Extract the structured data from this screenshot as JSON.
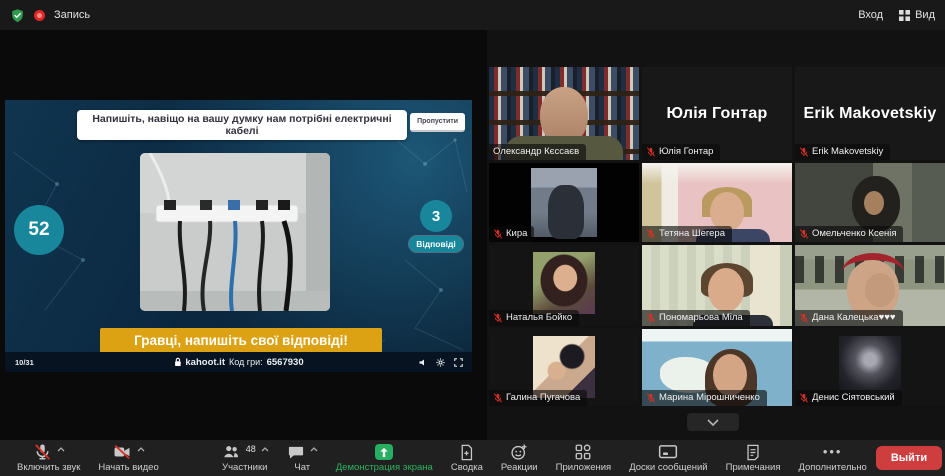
{
  "topbar": {
    "record_label": "Запись",
    "signin_label": "Вход",
    "view_label": "Вид"
  },
  "kahoot": {
    "question": "Напишіть, навіщо на вашу думку нам потрібні електричні кабелі",
    "skip_button": "Пропустити",
    "timer_seconds": "52",
    "answers_count": "3",
    "answers_label": "Відповіді",
    "banner": "Гравці, напишіть свої відповіді!",
    "slide_progress": "10/31",
    "site": "kahoot.it",
    "game_code_label": "Код гри:",
    "game_code": "6567930"
  },
  "gallery": {
    "participants": [
      {
        "name": "Олександр Кєссаєв",
        "muted": false,
        "video": "on",
        "active_speaker": true
      },
      {
        "name": "Юлія Гонтар",
        "muted": true,
        "video": "off-name"
      },
      {
        "name": "Erik Makovetskiy",
        "muted": true,
        "video": "off-name"
      },
      {
        "name": "Кира",
        "muted": true,
        "video": "on"
      },
      {
        "name": "Тетяна Шегера",
        "muted": true,
        "video": "on"
      },
      {
        "name": "Омельченко Ксенія",
        "muted": true,
        "video": "on"
      },
      {
        "name": "Наталья Бойко",
        "muted": true,
        "video": "off-avatar"
      },
      {
        "name": "Пономарьова Міла",
        "muted": true,
        "video": "on"
      },
      {
        "name": "Дана Калецька♥♥♥",
        "muted": true,
        "video": "on"
      },
      {
        "name": "Галина Пугачова",
        "muted": true,
        "video": "off-avatar"
      },
      {
        "name": "Марина Мірошниченко",
        "muted": true,
        "video": "on"
      },
      {
        "name": "Денис Сіятовський",
        "muted": true,
        "video": "off-avatar"
      }
    ]
  },
  "toolbar": {
    "items": [
      {
        "label": "Включить звук"
      },
      {
        "label": "Начать видео"
      },
      {
        "label": "Участники",
        "count": "48"
      },
      {
        "label": "Чат"
      },
      {
        "label": "Демонстрация экрана"
      },
      {
        "label": "Сводка"
      },
      {
        "label": "Реакции"
      },
      {
        "label": "Приложения"
      },
      {
        "label": "Доски сообщений"
      },
      {
        "label": "Примечания"
      },
      {
        "label": "Дополнительно"
      }
    ],
    "leave_button": "Выйти"
  },
  "colors": {
    "kahoot_teal": "#18879b",
    "banner_yellow": "#dca213",
    "share_green": "#27ae60",
    "leave_red": "#cf3e3e",
    "record_red": "#e02828",
    "muted_mic_red": "#d93025",
    "active_speaker_border": "#b9cf35"
  }
}
